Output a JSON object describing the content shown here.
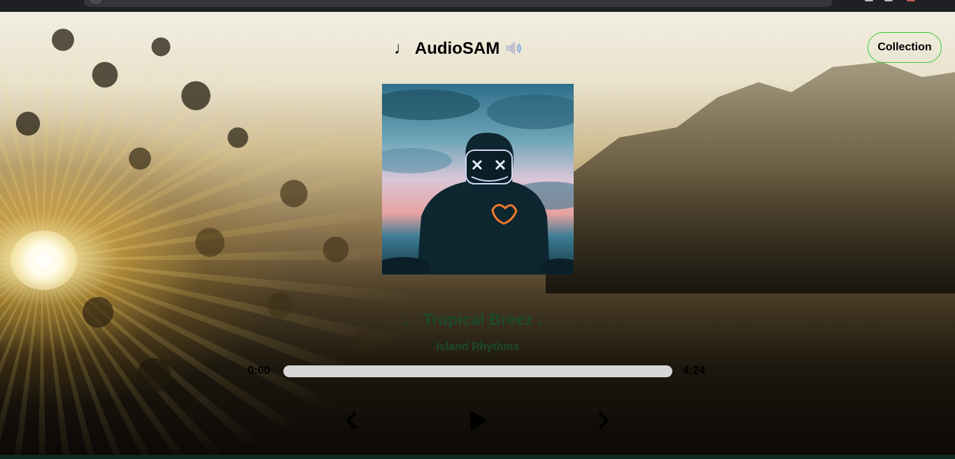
{
  "app": {
    "title_note": "♩",
    "title": "AudioSAM",
    "speaker_icon": "speaker-icon"
  },
  "header": {
    "collection_label": "Collection"
  },
  "song": {
    "title": "♩ Tropical Breez ♩",
    "artist": "Island Rhythms"
  },
  "player": {
    "current_time": "0:00",
    "total_time": "4:24",
    "progress_fraction": 0
  },
  "controls": {
    "prev_icon": "chevron-left-icon",
    "play_icon": "play-icon",
    "next_icon": "chevron-right-icon"
  },
  "colors": {
    "accent_border": "#37c837",
    "song_text": "#1b4a2c",
    "progress_track": "#d6d6d6"
  }
}
